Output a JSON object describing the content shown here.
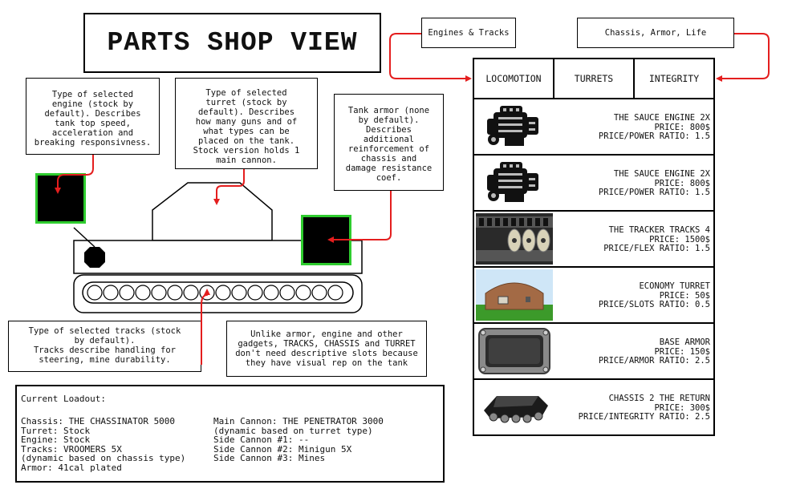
{
  "title": "PARTS SHOP VIEW",
  "callouts": {
    "engines_tracks": "Engines & Tracks",
    "chassis_armor_life": "Chassis, Armor, Life"
  },
  "notes": {
    "engine": "Type of selected\nengine (stock by\ndefault). Describes\ntank top speed,\nacceleration and\nbreaking responsivness.",
    "turret": "Type of selected\nturret (stock by\ndefault). Describes\nhow many guns and of\nwhat types can be\nplaced on the tank.\nStock version holds 1\nmain cannon.",
    "armor": "Tank armor (none\nby default).\nDescribes\nadditional\nreinforcement of\nchassis and\ndamage resistance\ncoef.",
    "tracks": "Type of selected tracks (stock\nby default).\nTracks describe handling for\nsteering, mine durability.",
    "visual_rep": "Unlike armor, engine and other\ngadgets, TRACKS, CHASSIS and TURRET\ndon't need descriptive slots because\nthey have visual rep on the tank"
  },
  "tabs": [
    {
      "label": "LOCOMOTION"
    },
    {
      "label": "TURRETS"
    },
    {
      "label": "INTEGRITY"
    }
  ],
  "items": [
    {
      "name": "THE SAUCE ENGINE 2X",
      "price": "PRICE: 800$",
      "ratio": "PRICE/POWER RATIO: 1.5",
      "icon": "engine-icon"
    },
    {
      "name": "THE SAUCE ENGINE 2X",
      "price": "PRICE: 800$",
      "ratio": "PRICE/POWER RATIO: 1.5",
      "icon": "engine-icon"
    },
    {
      "name": "THE TRACKER TRACKS 4",
      "price": "PRICE: 1500$",
      "ratio": "PRICE/FLEX RATIO: 1.5",
      "icon": "tracks-icon"
    },
    {
      "name": "ECONOMY TURRET",
      "price": "PRICE: 50$",
      "ratio": "PRICE/SLOTS RATIO: 0.5",
      "icon": "turret-icon"
    },
    {
      "name": "BASE ARMOR",
      "price": "PRICE: 150$",
      "ratio": "PRICE/ARMOR RATIO: 2.5",
      "icon": "armor-plate-icon"
    },
    {
      "name": "CHASSIS 2 THE RETURN",
      "price": "PRICE: 300$",
      "ratio": "PRICE/INTEGRITY RATIO: 2.5",
      "icon": "chassis-icon"
    }
  ],
  "loadout": {
    "heading": "Current Loadout:",
    "left": [
      "Chassis: THE CHASSINATOR 5000",
      "Turret: Stock",
      "Engine: Stock",
      "Tracks: VROOMERS 5X",
      "(dynamic based on chassis type)",
      "Armor: 41cal plated"
    ],
    "right": [
      "Main Cannon: THE PENETRATOR 3000",
      "(dynamic based on turret type)",
      "Side Cannon #1: --",
      "Side Cannon #2: Minigun 5X",
      "Side Cannon #3: Mines"
    ]
  },
  "colors": {
    "arrow": "#e41e1e",
    "slot_border": "#2ecc2e"
  }
}
